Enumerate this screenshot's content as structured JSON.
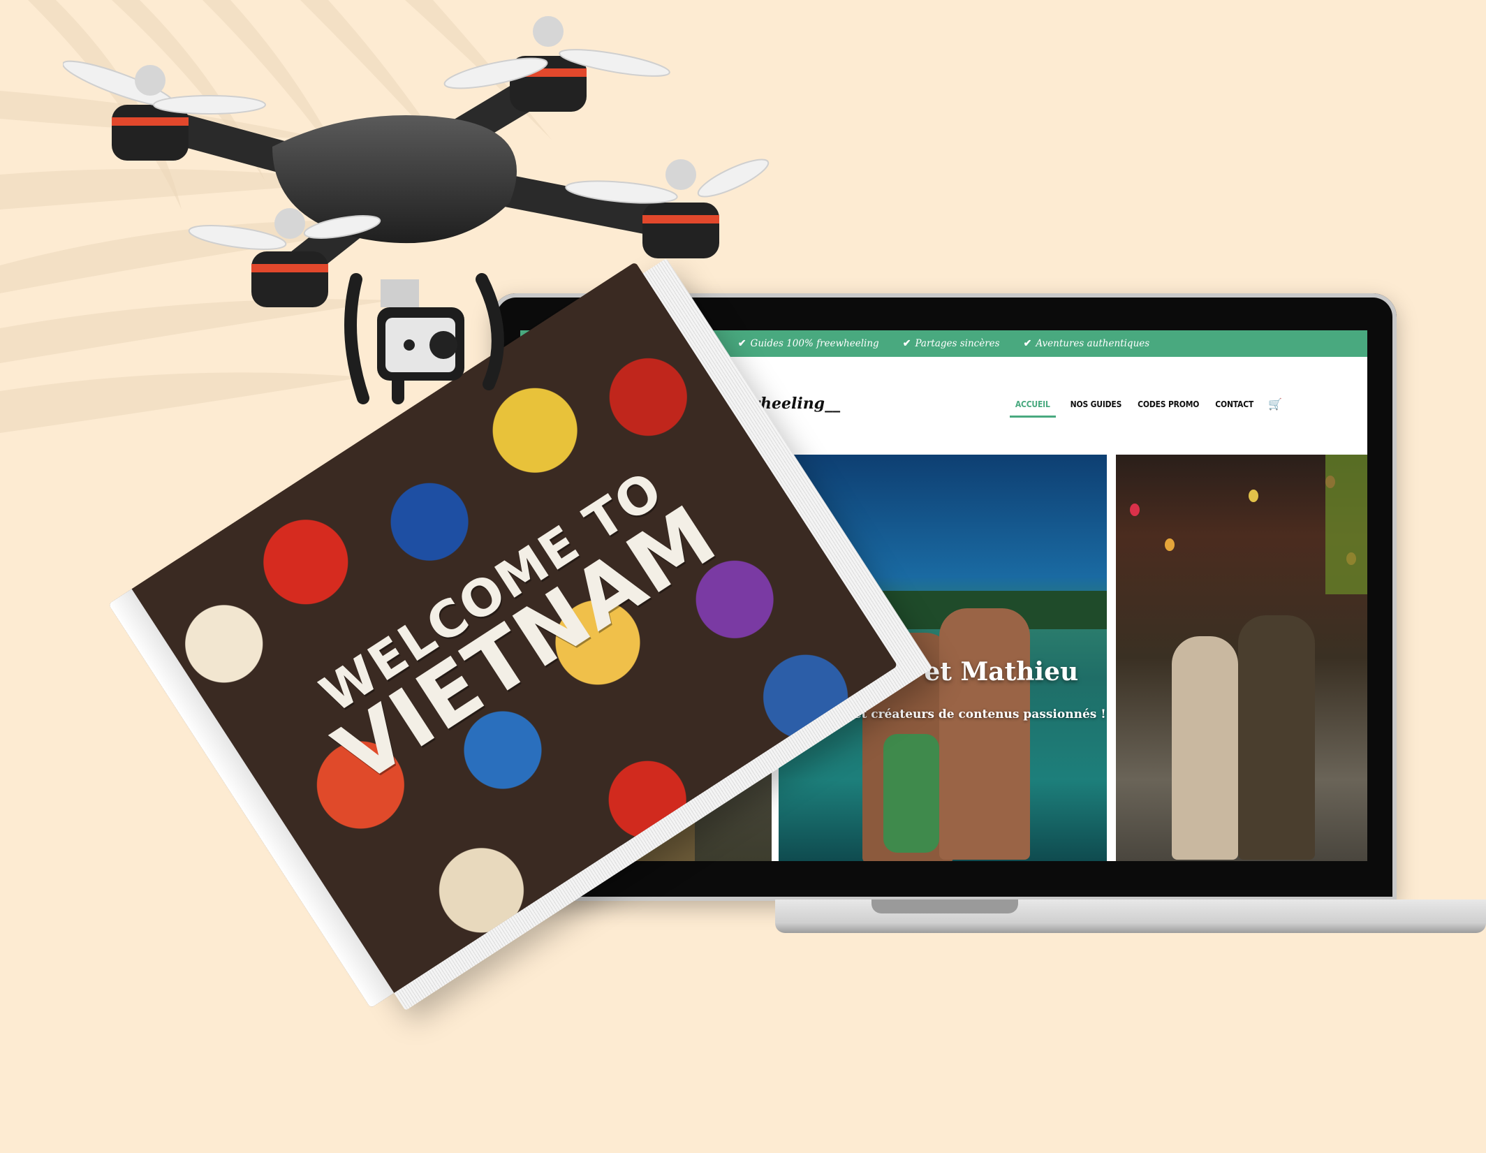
{
  "website": {
    "topbar": [
      {
        "label": "Guides 100% freewheeling"
      },
      {
        "label": "Partages sincères"
      },
      {
        "label": "Aventures authentiques"
      }
    ],
    "brand": "freewheeling__",
    "nav": [
      {
        "label": "ACCUEIL",
        "active": true
      },
      {
        "label": "NOS GUIDES"
      },
      {
        "label": "CODES PROMO"
      },
      {
        "label": "CONTACT"
      }
    ],
    "hero": {
      "title": "Pauline et Mathieu",
      "subtitle": "Voyageurs et créateurs de contenus passionnés !"
    },
    "accent_color": "#49a97f"
  },
  "book": {
    "title_line1": "WELCOME TO",
    "title_line2": "VIETNAM"
  },
  "icons": [
    "check-icon",
    "cart-icon",
    "drone-icon",
    "palm-leaf-shadow"
  ]
}
